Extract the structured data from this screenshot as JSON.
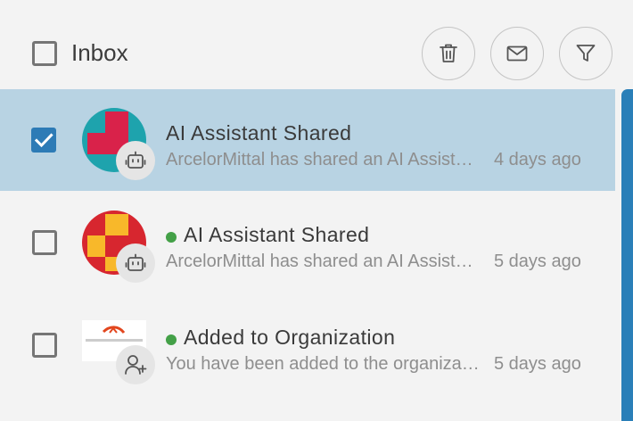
{
  "header": {
    "title": "Inbox",
    "actions": {
      "delete_icon": "trash-icon",
      "mark_read_icon": "mail-icon",
      "filter_icon": "filter-icon"
    }
  },
  "notifications": [
    {
      "title": "AI Assistant Shared",
      "preview": "ArcelorMittal has shared an AI Assistant",
      "time": "4 days ago",
      "checked": true,
      "unread": false,
      "badge_icon": "robot-icon"
    },
    {
      "title": "AI Assistant Shared",
      "preview": "ArcelorMittal has shared an AI Assistant",
      "time": "5 days ago",
      "checked": false,
      "unread": true,
      "badge_icon": "robot-icon"
    },
    {
      "title": "Added to Organization",
      "preview": "You have been added to the organization",
      "time": "5 days ago",
      "checked": false,
      "unread": true,
      "badge_icon": "user-add-icon"
    }
  ],
  "colors": {
    "selected_row": "#b8d3e3",
    "accent": "#2d7bb6",
    "unread_dot": "#43a047"
  }
}
